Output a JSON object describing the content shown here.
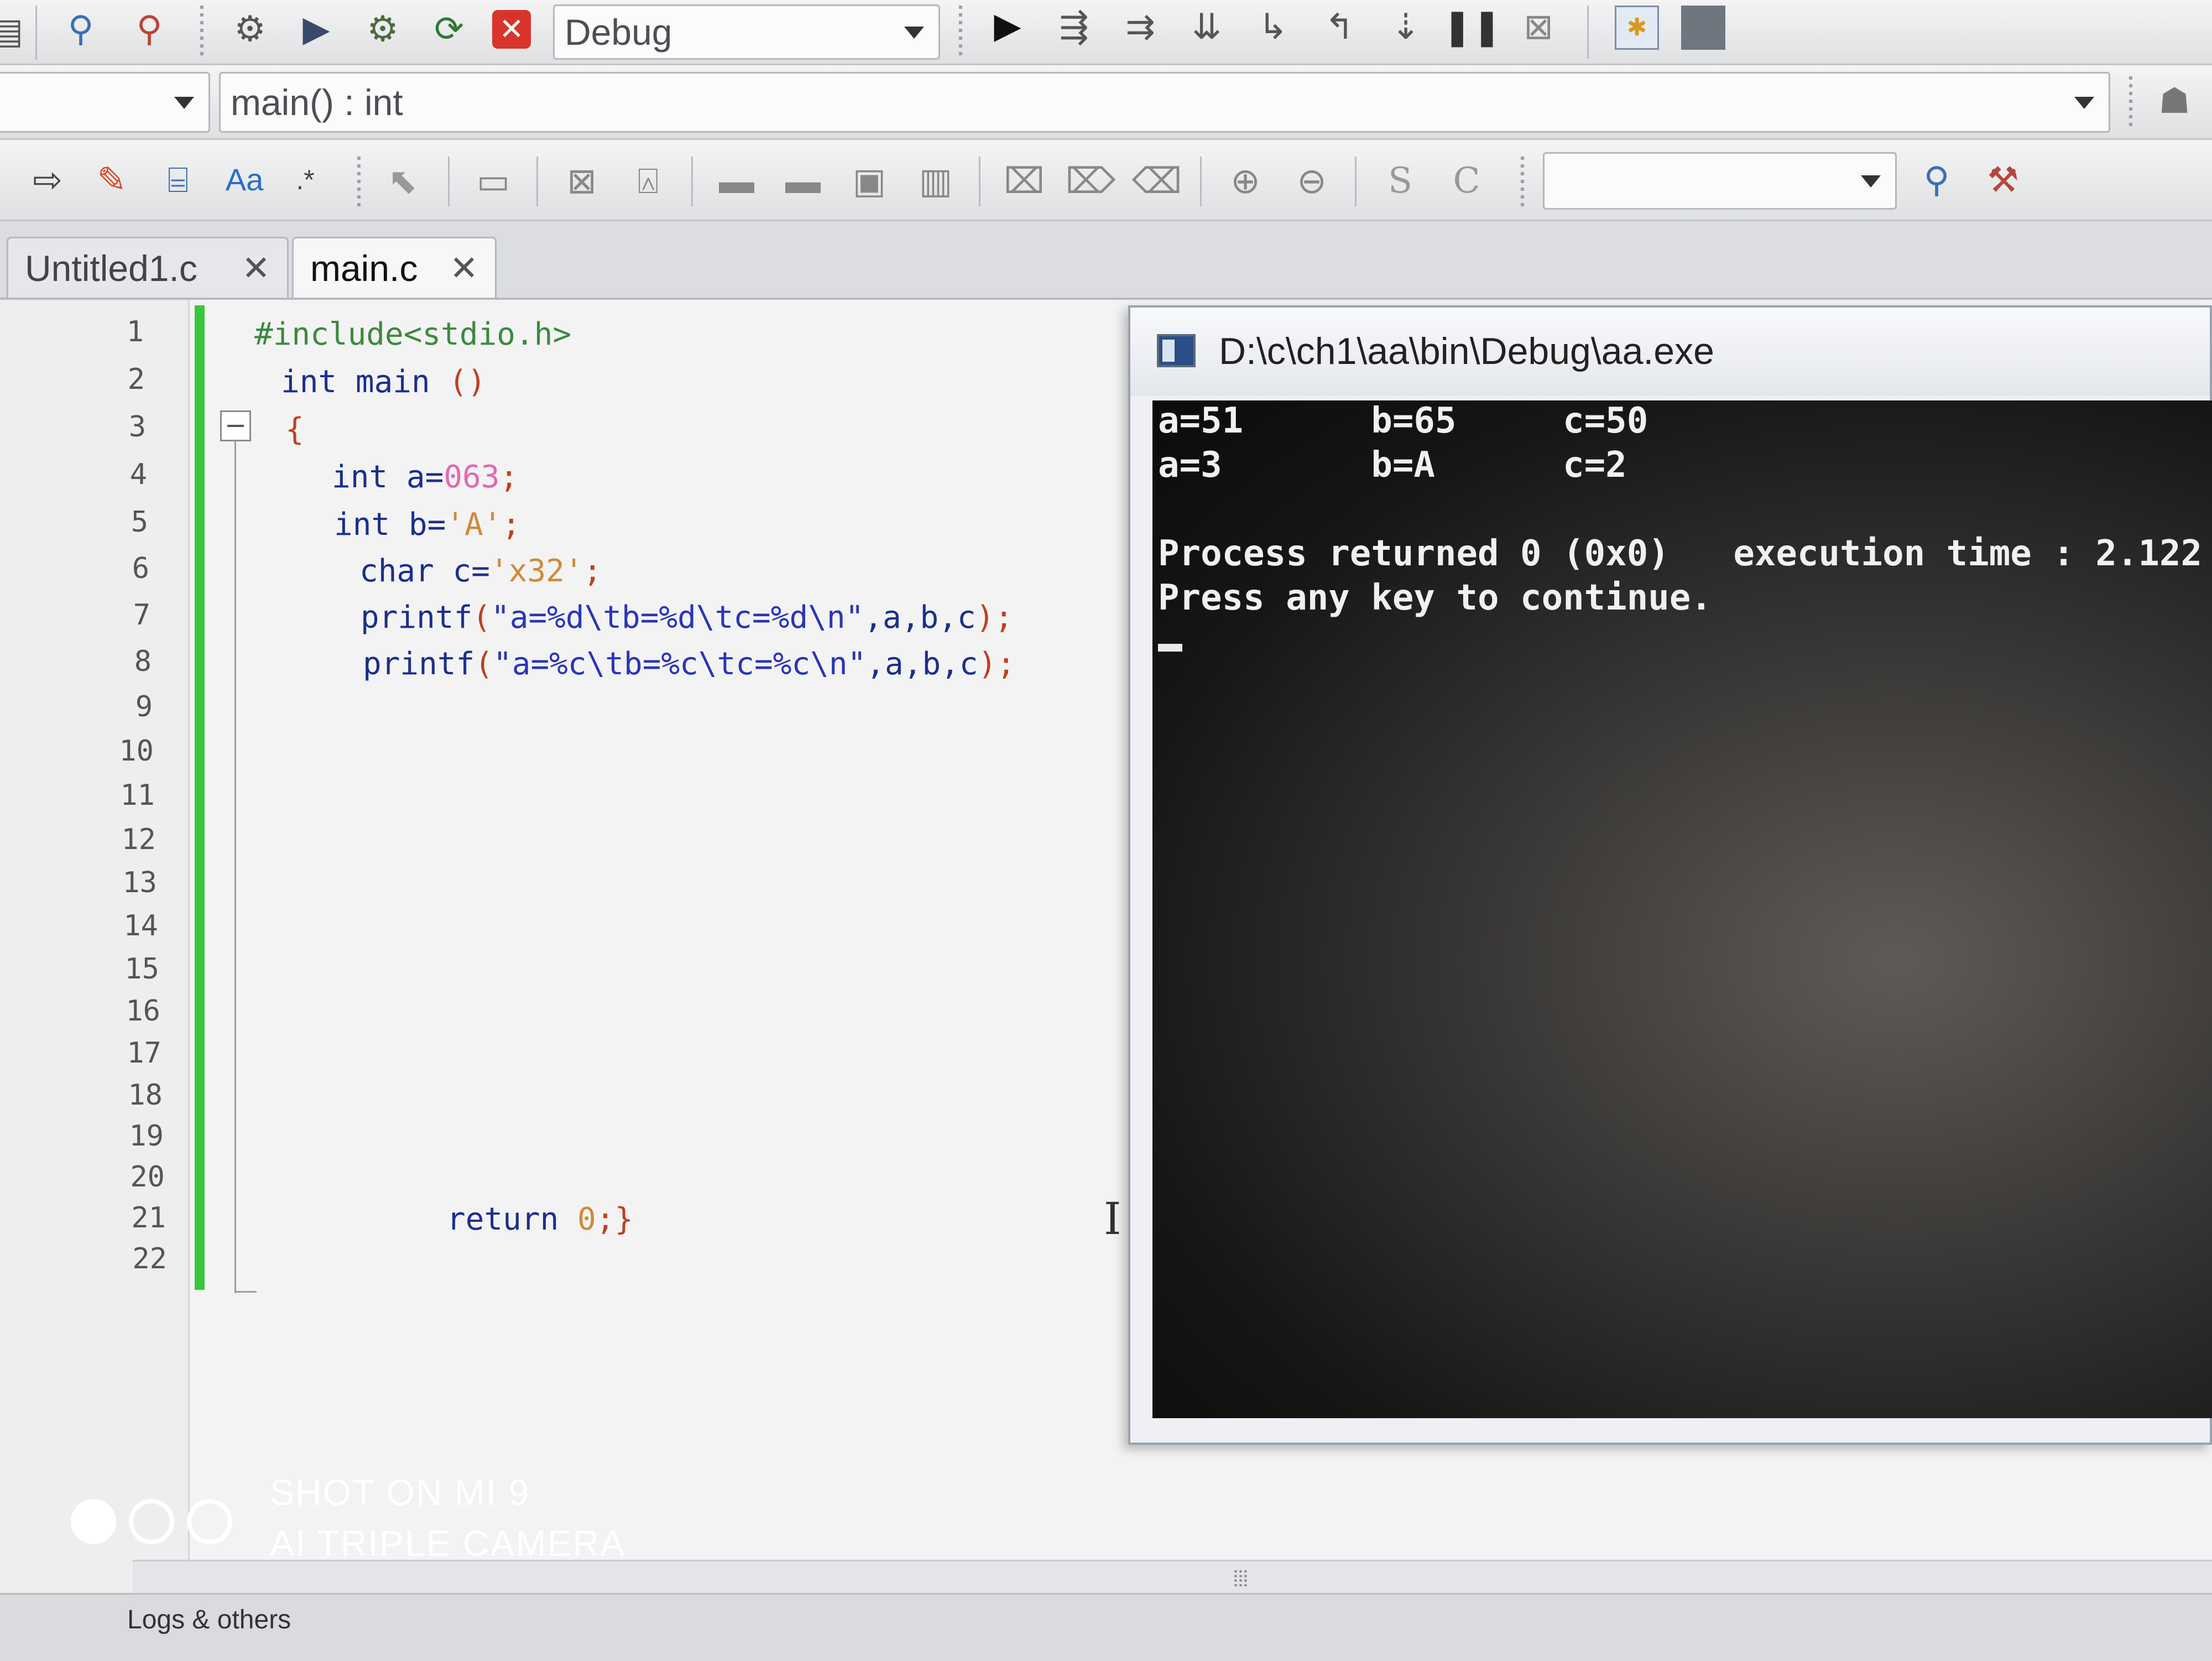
{
  "toolbar": {
    "build_target": "Debug",
    "function_scope": "main() : int"
  },
  "tabs": [
    {
      "label": "Untitled1.c",
      "active": false
    },
    {
      "label": "main.c",
      "active": true
    }
  ],
  "editor": {
    "line_numbers": [
      "1",
      "2",
      "3",
      "4",
      "5",
      "6",
      "7",
      "8",
      "9",
      "10",
      "11",
      "12",
      "13",
      "14",
      "15",
      "16",
      "17",
      "18",
      "19",
      "20",
      "21",
      "22"
    ],
    "code": {
      "l1": "#include<stdio.h>",
      "l2_kw": "int",
      "l2_rest": " main ",
      "l2_paren": "()",
      "l3": "{",
      "l4_kw": "int",
      "l4_var": " a=",
      "l4_val": "063",
      "l4_end": ";",
      "l5_kw": "int",
      "l5_var": " b=",
      "l5_val": "'A'",
      "l5_end": ";",
      "l6_kw": "char",
      "l6_var": " c=",
      "l6_val": "'x32'",
      "l6_end": ";",
      "l7_fn": "printf",
      "l7_open": "(",
      "l7_str": "\"a=%d\\tb=%d\\tc=%d\\n\"",
      "l7_args": ",a,b,c",
      "l7_close": ");",
      "l8_fn": "printf",
      "l8_open": "(",
      "l8_str": "\"a=%c\\tb=%c\\tc=%c\\n\"",
      "l8_args": ",a,b,c",
      "l8_close": ");",
      "l21_kw": "return",
      "l21_val": " 0",
      "l21_end": ";}"
    }
  },
  "console": {
    "title": "D:\\c\\ch1\\aa\\bin\\Debug\\aa.exe",
    "lines": [
      "a=51      b=65     c=50",
      "a=3       b=A      c=2",
      "",
      "Process returned 0 (0x0)   execution time : 2.122",
      "Press any key to continue."
    ]
  },
  "bottom_panel": {
    "logs_tab": "Logs & others"
  },
  "watermark": {
    "line1": "SHOT ON MI 9",
    "line2": "AI TRIPLE CAMERA"
  }
}
